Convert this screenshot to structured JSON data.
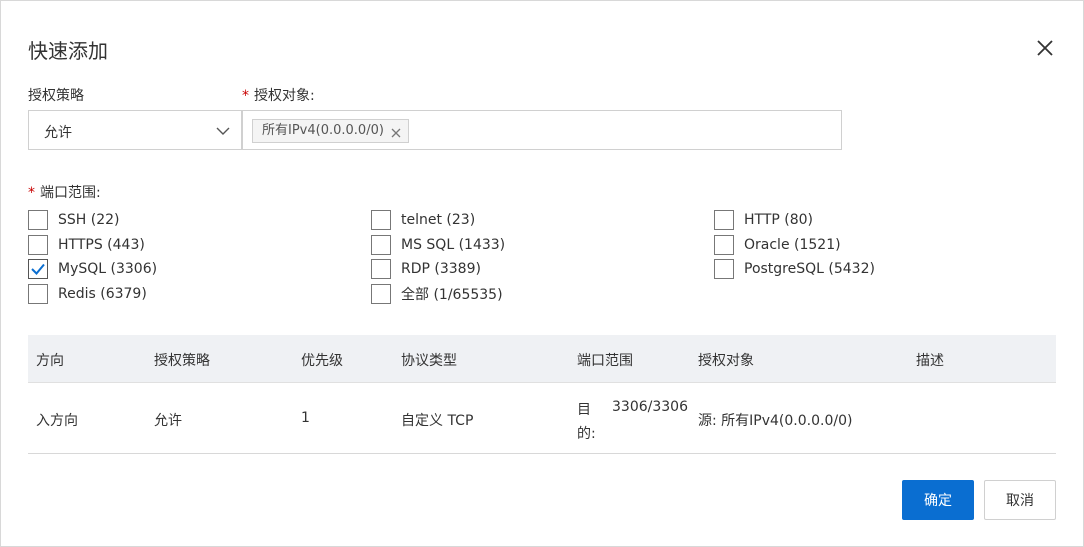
{
  "dialog": {
    "title": "快速添加",
    "close_icon": "close-icon"
  },
  "form": {
    "policy_label": "授权策略",
    "policy_value": "允许",
    "target_label": "授权对象:",
    "target_required": "*",
    "target_tags": [
      "所有IPv4(0.0.0.0/0)"
    ],
    "port_label": "端口范围:",
    "port_required": "*"
  },
  "ports": [
    {
      "label": "SSH (22)",
      "checked": false
    },
    {
      "label": "telnet (23)",
      "checked": false
    },
    {
      "label": "HTTP (80)",
      "checked": false
    },
    {
      "label": "HTTPS (443)",
      "checked": false
    },
    {
      "label": "MS SQL (1433)",
      "checked": false
    },
    {
      "label": "Oracle (1521)",
      "checked": false
    },
    {
      "label": "MySQL (3306)",
      "checked": true
    },
    {
      "label": "RDP (3389)",
      "checked": false
    },
    {
      "label": "PostgreSQL (5432)",
      "checked": false
    },
    {
      "label": "Redis (6379)",
      "checked": false
    },
    {
      "label": "全部 (1/65535)",
      "checked": false
    }
  ],
  "table": {
    "headers": [
      "方向",
      "授权策略",
      "优先级",
      "协议类型",
      "端口范围",
      "授权对象",
      "描述"
    ],
    "rows": [
      {
        "direction": "入方向",
        "policy": "允许",
        "priority": "1",
        "protocol": "自定义 TCP",
        "port_prefix_1": "目",
        "port_prefix_2": "的:",
        "port_value": "3306/3306",
        "target": "源: 所有IPv4(0.0.0.0/0)",
        "desc": ""
      }
    ]
  },
  "footer": {
    "confirm_label": "确定",
    "cancel_label": "取消"
  },
  "colors": {
    "primary": "#0a6ed1",
    "required": "#c80000",
    "header_bg": "#eff1f4"
  }
}
